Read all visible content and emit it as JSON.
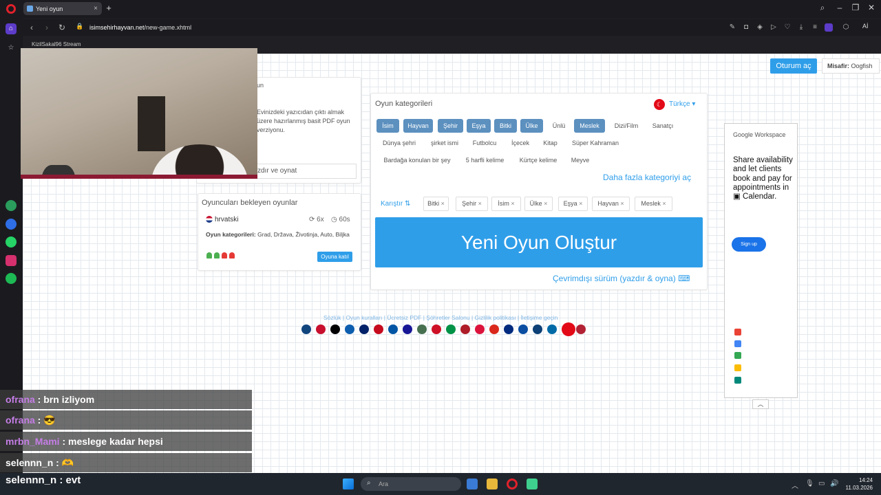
{
  "browser": {
    "tab_title": "Yeni oyun",
    "url_domain": "isimsehirhayvan.net",
    "url_path": "/new-game.xhtml",
    "bookmark": "KizilSakal96 Stream",
    "ai_label": "Aİ"
  },
  "header": {
    "login_label": "Oturum aç",
    "guest_prefix": "Misafir:",
    "guest_name": "Oogfish"
  },
  "left_panel": {
    "fragment": "un",
    "pdf_text": "Evinizdeki yazıcıdan çıktı almak üzere hazırlanmış basit PDF oyun verziyonu.",
    "print_input": "zdır ve oynat"
  },
  "waiting": {
    "title": "Oyuncuları bekleyen oyunlar",
    "language": "hrvatski",
    "rounds": "6x",
    "time": "60s",
    "cats_label": "Oyun kategorileri:",
    "cats_value": "Grad, Država, Životinja, Auto, Biljka",
    "join_label": "Oyuna katıl"
  },
  "main": {
    "title": "Oyun kategorileri",
    "language": "Türkçe",
    "categories": [
      {
        "label": "İsim",
        "on": true
      },
      {
        "label": "Hayvan",
        "on": true
      },
      {
        "label": "Şehir",
        "on": true
      },
      {
        "label": "Eşya",
        "on": true
      },
      {
        "label": "Bitki",
        "on": true
      },
      {
        "label": "Ülke",
        "on": true
      },
      {
        "label": "Ünlü",
        "on": false
      },
      {
        "label": "Meslek",
        "on": true
      },
      {
        "label": "Dizi/Film",
        "on": false
      },
      {
        "label": "Sanatçı",
        "on": false
      },
      {
        "label": "Dünya şehri",
        "on": false
      },
      {
        "label": "şirket ismi",
        "on": false
      },
      {
        "label": "Futbolcu",
        "on": false
      },
      {
        "label": "İçecek",
        "on": false
      },
      {
        "label": "Kitap",
        "on": false
      },
      {
        "label": "Süper Kahraman",
        "on": false
      },
      {
        "label": "Bardağa konulan bir şey",
        "on": false
      },
      {
        "label": "5 harfli kelime",
        "on": false
      },
      {
        "label": "Kürtçe kelime",
        "on": false
      },
      {
        "label": "Meyve",
        "on": false
      }
    ],
    "more_label": "Daha fazla kategoriyi aç",
    "shuffle_label": "Karıştır",
    "selected": [
      "Bitki",
      "Şehir",
      "İsim",
      "Ülke",
      "Eşya",
      "Hayvan",
      "Meslek"
    ],
    "create_label": "Yeni Oyun Oluştur",
    "offline_label": "Çevrimdışı sürüm (yazdır & oyna)"
  },
  "ad": {
    "brand": "Google Workspace",
    "text": "Share availability and let clients book and pay for appointments in ▣ Calendar.",
    "button": "Sign up"
  },
  "footer": {
    "links": "Sözlük | Oyun kuralları | Ücretsiz PDF | Şöhretler Salonu | Gizlilik politikası | İletişime geçin"
  },
  "chat": [
    {
      "user": "ofrana",
      "msg": "brn izliyom"
    },
    {
      "user": "ofrana",
      "msg": ""
    },
    {
      "user": "mrbn_Mami",
      "msg": "meslege kadar hepsi"
    },
    {
      "user": "selennn_n",
      "msg": ""
    }
  ],
  "chat_last": {
    "user": "selennn_n",
    "msg": "evt"
  },
  "taskbar": {
    "search_placeholder": "Ara",
    "time": "14:24",
    "date": "11.03.2026"
  }
}
